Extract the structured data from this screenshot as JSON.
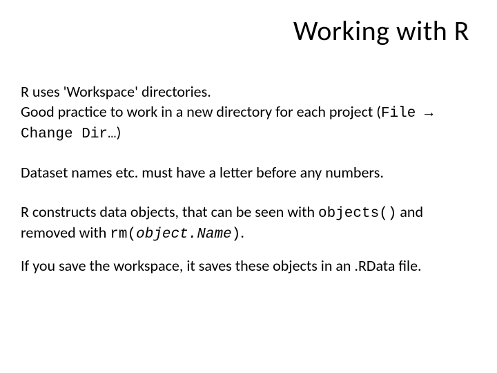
{
  "title": "Working with R",
  "p1a": "R uses 'Workspace' directories.",
  "p1b_pre": "Good practice to work in a new directory for each project (",
  "p1b_code": "File → Change Dir…",
  "p1b_post": ")",
  "p2": "Dataset names etc. must have a letter before any numbers.",
  "p3_pre": "R constructs data objects, that can be seen with ",
  "p3_code1": "objects()",
  "p3_mid": " and removed with ",
  "p3_code2a": "rm(",
  "p3_code2b": "object.Name",
  "p3_code2c": ")",
  "p3_post": ".",
  "p4": "If you save the workspace, it saves these objects in an .RData file."
}
